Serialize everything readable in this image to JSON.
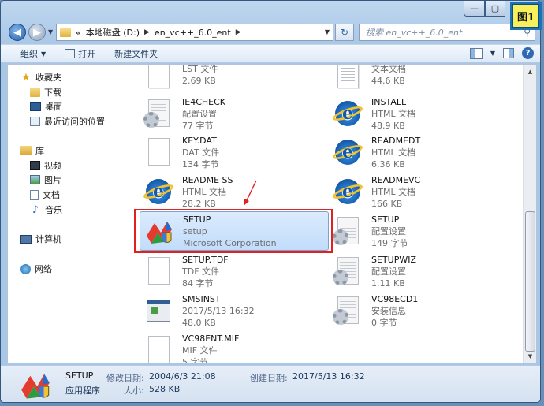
{
  "titlebar": {
    "minimize": "—",
    "maximize": "▢",
    "figure_label": "图1"
  },
  "nav": {
    "back": "◀",
    "forward": "▶",
    "crumbs": [
      "«",
      "本地磁盘 (D:)",
      "en_vc++_6.0_ent"
    ],
    "search_placeholder": "搜索 en_vc++_6.0_ent"
  },
  "toolbar": {
    "organize": "组织",
    "open": "打开",
    "new_folder": "新建文件夹"
  },
  "sidebar": {
    "favorites": "收藏夹",
    "downloads": "下载",
    "desktop": "桌面",
    "recent": "最近访问的位置",
    "libraries": "库",
    "videos": "视频",
    "pictures": "图片",
    "documents": "文档",
    "music": "音乐",
    "computer": "计算机",
    "network": "网络"
  },
  "files": [
    {
      "name": "",
      "type": "LST 文件",
      "size": "2.69 KB",
      "icon": "page-icon"
    },
    {
      "name": "",
      "type": "文本文档",
      "size": "44.6 KB",
      "icon": "text-doc-icon"
    },
    {
      "name": "IE4CHECK",
      "type": "配置设置",
      "size": "77 字节",
      "icon": "config-gear-icon"
    },
    {
      "name": "INSTALL",
      "type": "HTML 文档",
      "size": "48.9 KB",
      "icon": "ie-icon"
    },
    {
      "name": "KEY.DAT",
      "type": "DAT 文件",
      "size": "134 字节",
      "icon": "page-icon"
    },
    {
      "name": "READMEDT",
      "type": "HTML 文档",
      "size": "6.36 KB",
      "icon": "ie-icon"
    },
    {
      "name": "README SS",
      "type": "HTML 文档",
      "size": "28.2 KB",
      "icon": "ie-icon"
    },
    {
      "name": "READMEVC",
      "type": "HTML 文档",
      "size": "166 KB",
      "icon": "ie-icon"
    },
    {
      "name": "SETUP",
      "type": "setup",
      "size": "Microsoft Corporation",
      "icon": "setup-app-icon"
    },
    {
      "name": "SETUP",
      "type": "配置设置",
      "size": "149 字节",
      "icon": "config-gear-icon"
    },
    {
      "name": "SETUP.TDF",
      "type": "TDF 文件",
      "size": "84 字节",
      "icon": "page-icon"
    },
    {
      "name": "SETUPWIZ",
      "type": "配置设置",
      "size": "1.11 KB",
      "icon": "config-gear-icon"
    },
    {
      "name": "SMSINST",
      "type": "2017/5/13 16:32",
      "size": "48.0 KB",
      "icon": "app-window-icon"
    },
    {
      "name": "VC98ECD1",
      "type": "安装信息",
      "size": "0 字节",
      "icon": "config-gear-icon"
    },
    {
      "name": "VC98ENT.MIF",
      "type": "MIF 文件",
      "size": "5 字节",
      "icon": "page-icon"
    }
  ],
  "details": {
    "name": "SETUP",
    "type": "应用程序",
    "modified_label": "修改日期:",
    "modified": "2004/6/3 21:08",
    "created_label": "创建日期:",
    "created": "2017/5/13 16:32",
    "size_label": "大小:",
    "size": "528 KB"
  }
}
